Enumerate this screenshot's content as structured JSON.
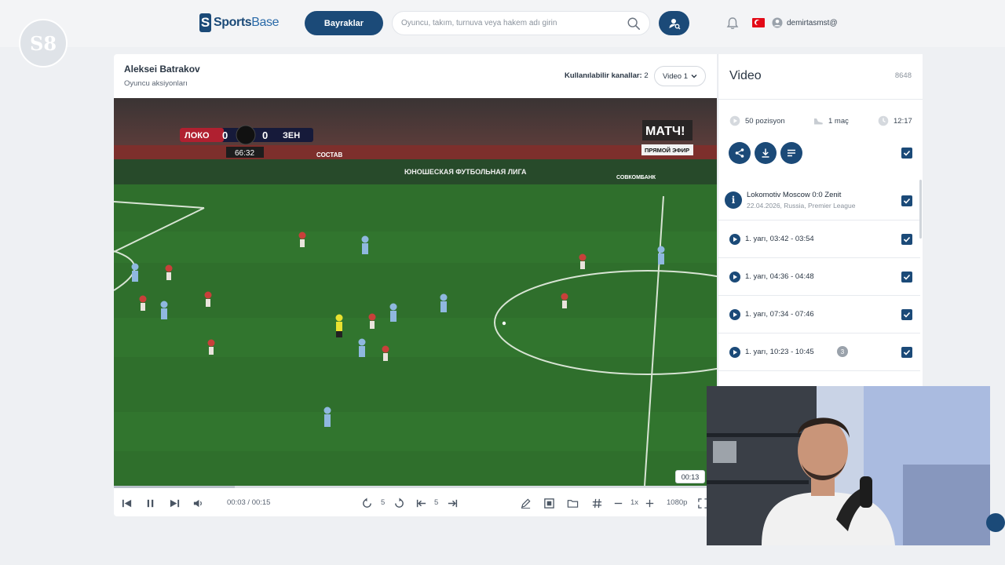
{
  "header": {
    "badge_text": "S8",
    "brand_s": "S",
    "brand_part1": "Sports",
    "brand_part2": "Base",
    "flags_button": "Bayraklar",
    "search_placeholder": "Oyuncu, takım, turnuva veya hakem adı girin",
    "username": "demirtasmst@"
  },
  "player": {
    "title": "Aleksei Batrakov",
    "subtitle": "Oyuncu aksiyonları",
    "channels_label": "Kullanılabilir kanallar:",
    "channels_count": "2",
    "video_select": "Video 1",
    "progress_fraction": 0.2,
    "tooltip_time": "00:13",
    "time_display": "00:03 / 00:15",
    "rewind_seconds": "5",
    "skip_frames": "5",
    "speed": "1x",
    "quality": "1080p"
  },
  "broadcast": {
    "home": "ЛОКО",
    "home_score": "0",
    "away_score": "0",
    "away": "ЗЕН",
    "clock": "66:32",
    "channel": "МАТЧ!",
    "live": "ПРЯМОЙ ЭФИР",
    "ad1": "СОСТАВ",
    "ad2": "ЮНОШЕСКАЯ ФУТБОЛЬНАЯ ЛИГА",
    "ad3": "СОВКОМБАНК"
  },
  "panel": {
    "title": "Video",
    "count": "8648",
    "positions": "50 pozisyon",
    "matches": "1 maç",
    "duration": "12:17",
    "match": {
      "title": "Lokomotiv Moscow 0:0 Zenit",
      "meta": "22.04.2026, Russia, Premier League"
    },
    "clips": [
      {
        "label": "1. yarı, 03:42 - 03:54",
        "badge": ""
      },
      {
        "label": "1. yarı, 04:36 - 04:48",
        "badge": ""
      },
      {
        "label": "1. yarı, 07:34 - 07:46",
        "badge": ""
      },
      {
        "label": "1. yarı, 10:23 - 10:45",
        "badge": "3"
      }
    ]
  },
  "colors": {
    "brand": "#1b4a78",
    "pitch": "#2f6f2c",
    "home_kit": "#c8403a",
    "away_kit": "#8fb8df"
  }
}
